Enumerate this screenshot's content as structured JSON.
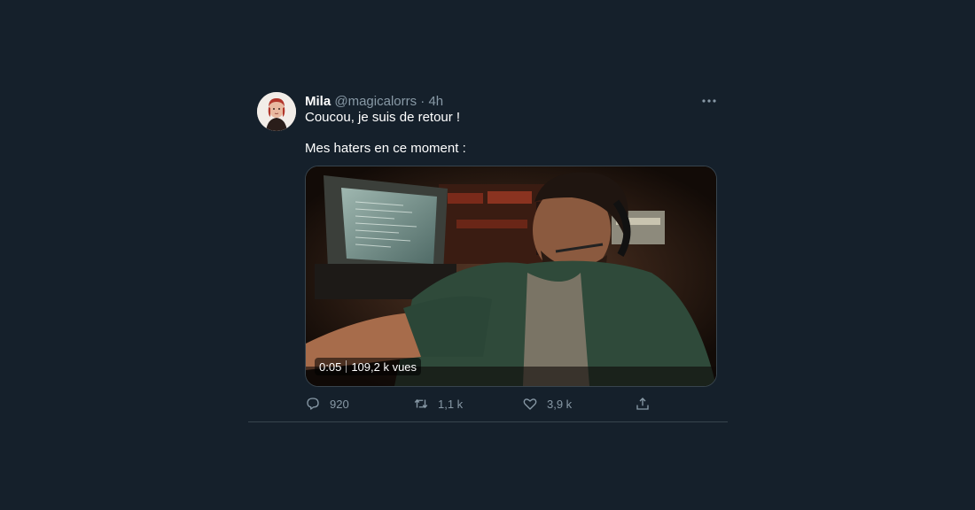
{
  "tweet": {
    "author_name": "Mila",
    "handle": "@magicalorrs",
    "separator": "·",
    "time": "4h",
    "text_line1": "Coucou, je suis de retour !",
    "text_line2": "Mes haters en ce moment :",
    "media": {
      "duration": "0:05",
      "views": "109,2 k vues"
    },
    "actions": {
      "replies": "920",
      "retweets": "1,1 k",
      "likes": "3,9 k"
    }
  },
  "icons": {
    "more": "more-horizontal-icon",
    "reply": "speech-bubble-icon",
    "retweet": "retweet-arrows-icon",
    "like": "heart-icon",
    "share": "share-upload-icon"
  },
  "colors": {
    "background": "#15202b",
    "secondary_text": "#8899a6",
    "border": "#38444d"
  }
}
